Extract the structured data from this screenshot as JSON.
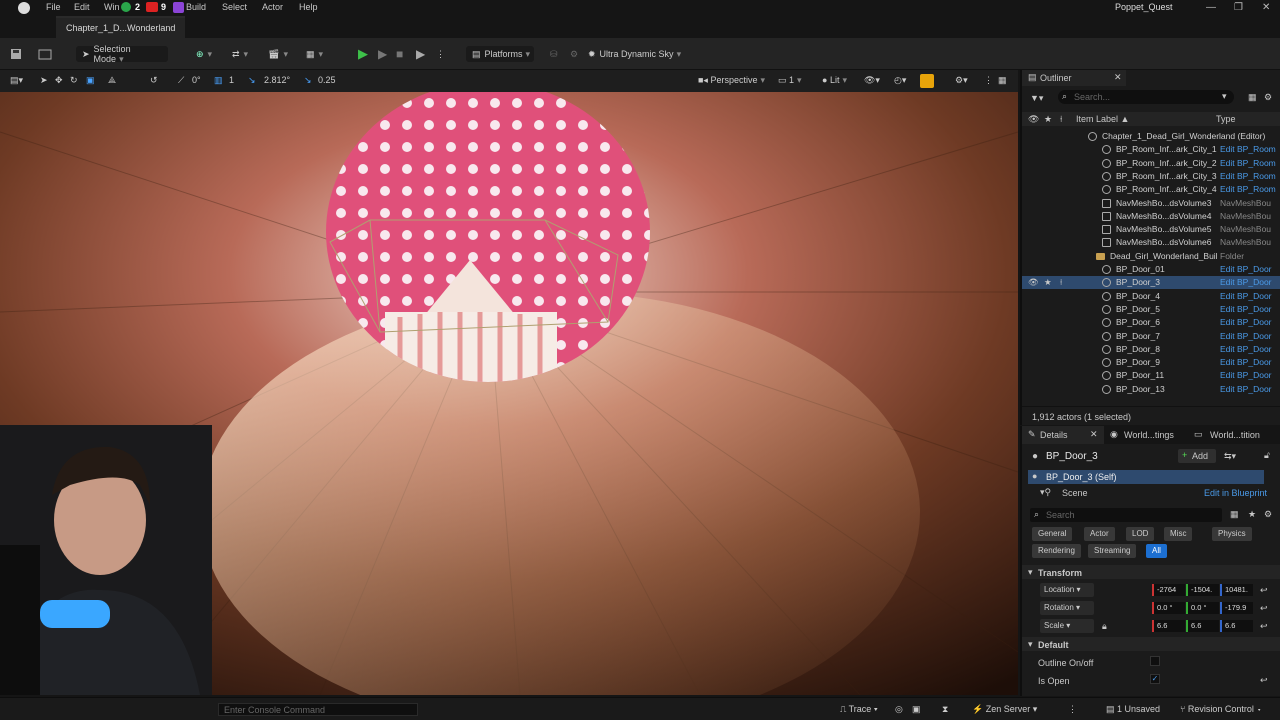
{
  "menu": [
    "File",
    "Edit",
    "Win",
    "Build",
    "Select",
    "Actor",
    "Help"
  ],
  "overlay_badges": {
    "green": "2",
    "red": "9"
  },
  "app_title": "Poppet_Quest",
  "document_tab": "Chapter_1_D...Wonderland",
  "toolbar": {
    "selection_mode": "Selection Mode",
    "platforms": "Platforms",
    "sky": "Ultra Dynamic Sky"
  },
  "viewport_toolbar": {
    "rotation_snap": "0°",
    "scale_snap_count": "1",
    "camera_speed": "2.812°",
    "grid_snap": "0.25",
    "perspective": "Perspective",
    "view_count": "1",
    "lit": "Lit"
  },
  "outliner": {
    "tab_title": "Outliner",
    "search_placeholder": "Search...",
    "col_label": "Item Label ▲",
    "col_type": "Type",
    "rows": [
      {
        "label": "Chapter_1_Dead_Girl_Wonderland (Editor)",
        "type": "",
        "kind": "world"
      },
      {
        "label": "BP_Room_Inf...ark_City_1",
        "type": "Edit BP_Room",
        "kind": "bp"
      },
      {
        "label": "BP_Room_Inf...ark_City_2",
        "type": "Edit BP_Room",
        "kind": "bp"
      },
      {
        "label": "BP_Room_Inf...ark_City_3",
        "type": "Edit BP_Room",
        "kind": "bp"
      },
      {
        "label": "BP_Room_Inf...ark_City_4",
        "type": "Edit BP_Room",
        "kind": "bp"
      },
      {
        "label": "NavMeshBo...dsVolume3",
        "type": "NavMeshBou",
        "kind": "vol"
      },
      {
        "label": "NavMeshBo...dsVolume4",
        "type": "NavMeshBou",
        "kind": "vol"
      },
      {
        "label": "NavMeshBo...dsVolume5",
        "type": "NavMeshBou",
        "kind": "vol"
      },
      {
        "label": "NavMeshBo...dsVolume6",
        "type": "NavMeshBou",
        "kind": "vol"
      },
      {
        "label": "Dead_Girl_Wonderland_Buil",
        "type": "Folder",
        "kind": "folder"
      },
      {
        "label": "BP_Door_01",
        "type": "Edit BP_Door",
        "kind": "bp"
      },
      {
        "label": "BP_Door_3",
        "type": "Edit BP_Door",
        "kind": "bp",
        "selected": true
      },
      {
        "label": "BP_Door_4",
        "type": "Edit BP_Door",
        "kind": "bp"
      },
      {
        "label": "BP_Door_5",
        "type": "Edit BP_Door",
        "kind": "bp"
      },
      {
        "label": "BP_Door_6",
        "type": "Edit BP_Door",
        "kind": "bp"
      },
      {
        "label": "BP_Door_7",
        "type": "Edit BP_Door",
        "kind": "bp"
      },
      {
        "label": "BP_Door_8",
        "type": "Edit BP_Door",
        "kind": "bp"
      },
      {
        "label": "BP_Door_9",
        "type": "Edit BP_Door",
        "kind": "bp"
      },
      {
        "label": "BP_Door_11",
        "type": "Edit BP_Door",
        "kind": "bp"
      },
      {
        "label": "BP_Door_13",
        "type": "Edit BP_Door",
        "kind": "bp"
      }
    ],
    "footer": "1,912 actors (1 selected)"
  },
  "details": {
    "tabs": [
      "Details",
      "World...tings",
      "World...tition"
    ],
    "actor_name": "BP_Door_3",
    "add_label": "Add",
    "component_self": "BP_Door_3 (Self)",
    "component_scene": "Scene",
    "edit_in_blueprint": "Edit in Blueprint",
    "search_placeholder": "Search",
    "filters_row1": [
      "General",
      "Actor",
      "LOD",
      "Misc",
      "Physics"
    ],
    "filters_row2": [
      "Rendering",
      "Streaming",
      "All"
    ],
    "section_transform": "Transform",
    "location_label": "Location",
    "rotation_label": "Rotation",
    "scale_label": "Scale",
    "location": [
      "-2764",
      "-1504.",
      "10481."
    ],
    "rotation": [
      "0.0 °",
      "0.0 °",
      "-179.9"
    ],
    "scale": [
      "6.6",
      "6.6",
      "6.6"
    ],
    "section_default": "Default",
    "outline_label": "Outline On/off",
    "is_open_label": "Is Open"
  },
  "statusbar": {
    "console_placeholder": "Enter Console Command",
    "trace": "Trace",
    "zen": "Zen Server",
    "unsaved": "1 Unsaved",
    "revision": "Revision Control"
  }
}
